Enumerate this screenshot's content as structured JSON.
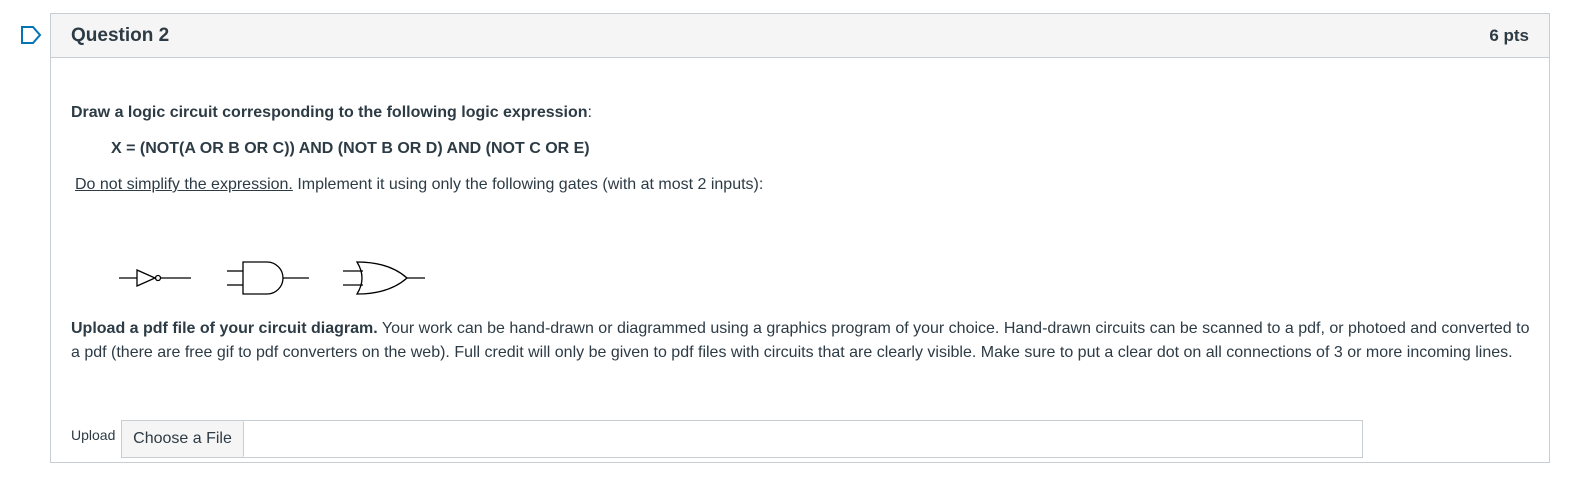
{
  "question": {
    "title": "Question 2",
    "points": "6 pts"
  },
  "body": {
    "instruction_bold": "Draw a logic circuit corresponding to the following logic expression",
    "instruction_suffix": ":",
    "expression": "X = (NOT(A OR B OR C)) AND (NOT B OR D) AND (NOT C OR E)",
    "note_underlined": "Do not simplify the expression.",
    "note_rest": " Implement it using only the following gates (with at most 2 inputs):",
    "gates": [
      "not-gate-icon",
      "and-gate-icon",
      "or-gate-icon"
    ],
    "upload_instruction_bold": "Upload a pdf file of your circuit diagram.",
    "upload_instruction_rest": " Your work can be hand-drawn  or diagrammed using a graphics program of your choice. Hand-drawn circuits can be scanned to a pdf, or photoed and converted to a pdf (there are free gif to pdf converters on the web). Full credit will only be given to pdf files with circuits that are clearly visible. Make sure to put a clear dot on all connections of 3 or more incoming lines."
  },
  "upload": {
    "label": "Upload",
    "button_label": "Choose a File"
  },
  "colors": {
    "text": "#2d3b45",
    "border": "#c7cdd1",
    "header_bg": "#f5f5f5",
    "flag": "#0374b5"
  }
}
